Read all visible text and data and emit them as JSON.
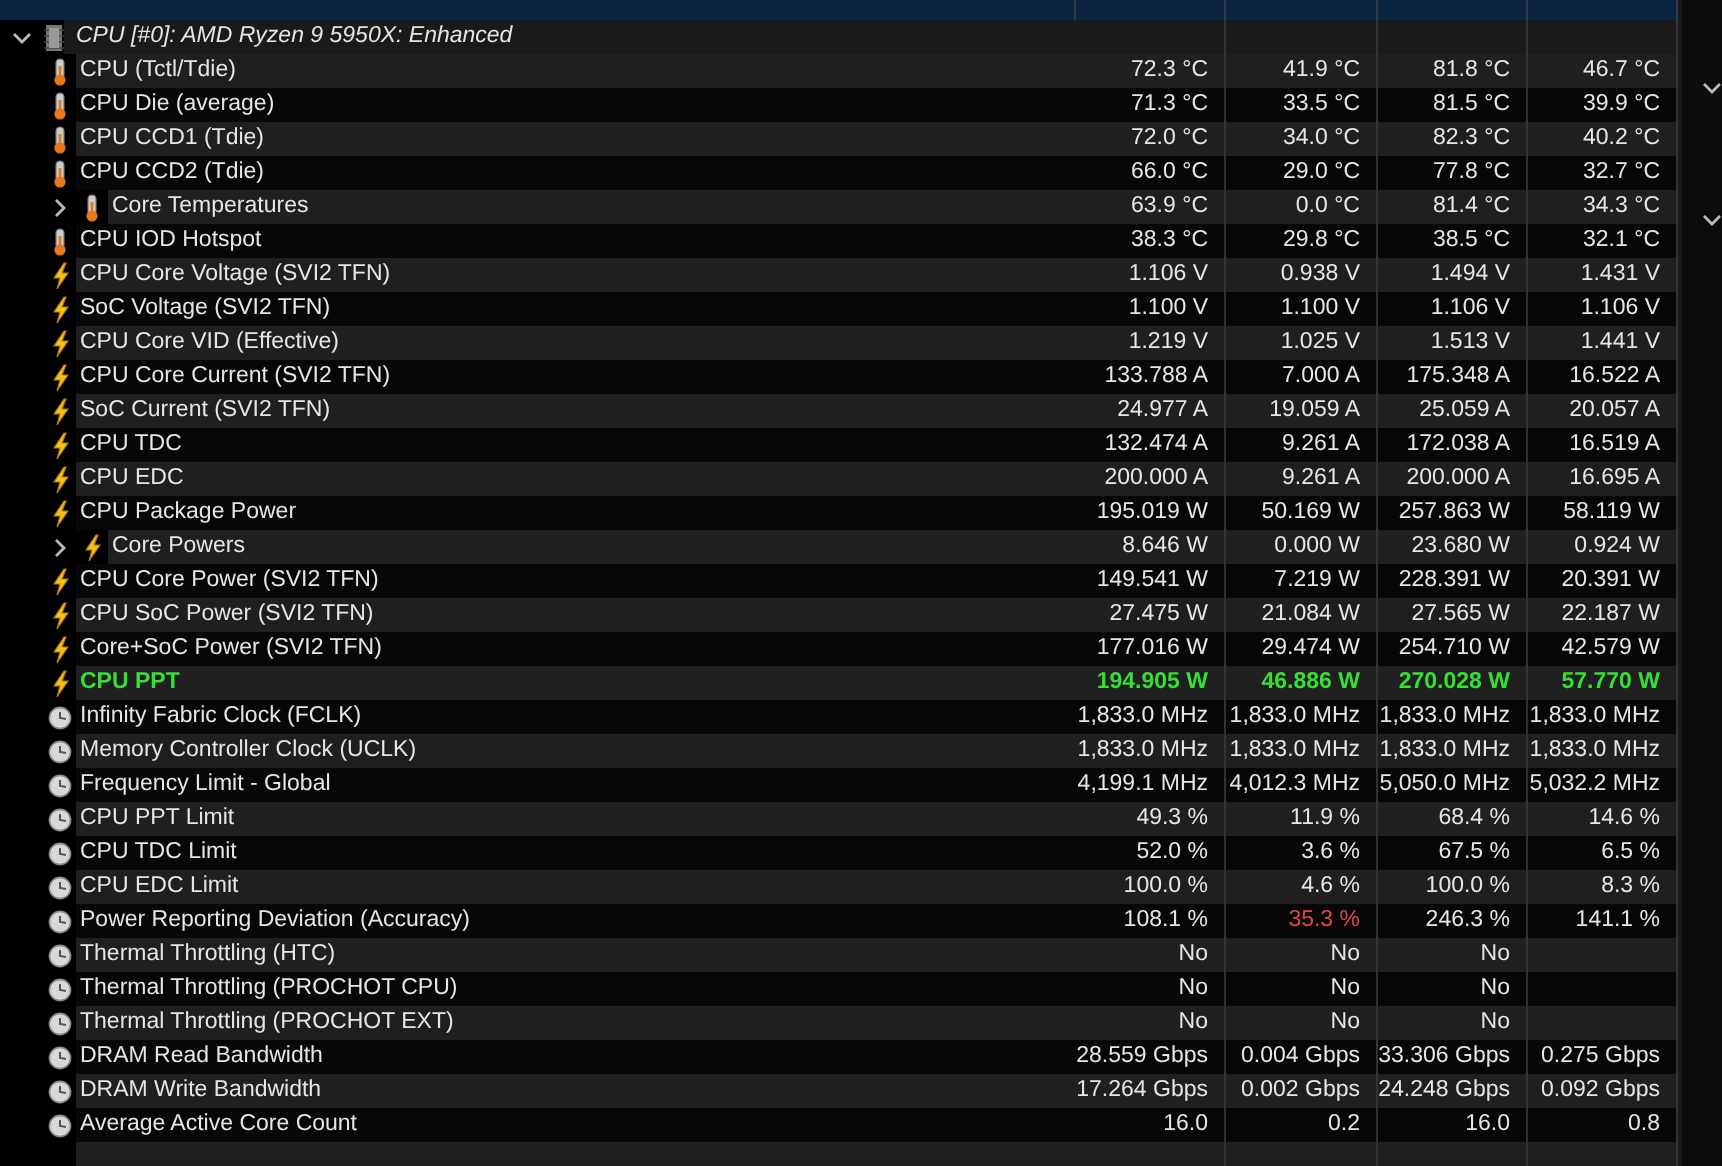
{
  "sensor_group": {
    "title": "CPU [#0]: AMD Ryzen 9 5950X: Enhanced",
    "expanded": true,
    "rows": [
      {
        "kind": "temp",
        "name": "CPU (Tctl/Tdie)",
        "highlight": false,
        "values": [
          "72.3 °C",
          "41.9 °C",
          "81.8 °C",
          "46.7 °C"
        ]
      },
      {
        "kind": "temp",
        "name": "CPU Die (average)",
        "highlight": false,
        "values": [
          "71.3 °C",
          "33.5 °C",
          "81.5 °C",
          "39.9 °C"
        ]
      },
      {
        "kind": "temp",
        "name": "CPU CCD1 (Tdie)",
        "highlight": false,
        "values": [
          "72.0 °C",
          "34.0 °C",
          "82.3 °C",
          "40.2 °C"
        ]
      },
      {
        "kind": "temp",
        "name": "CPU CCD2 (Tdie)",
        "highlight": false,
        "values": [
          "66.0 °C",
          "29.0 °C",
          "77.8 °C",
          "32.7 °C"
        ]
      },
      {
        "kind": "temp",
        "name": "Core Temperatures",
        "expanded": false,
        "highlight": false,
        "values": [
          "63.9 °C",
          "0.0 °C",
          "81.4 °C",
          "34.3 °C"
        ]
      },
      {
        "kind": "temp",
        "name": "CPU IOD Hotspot",
        "highlight": false,
        "values": [
          "38.3 °C",
          "29.8 °C",
          "38.5 °C",
          "32.1 °C"
        ]
      },
      {
        "kind": "power",
        "name": "CPU Core Voltage (SVI2 TFN)",
        "highlight": false,
        "values": [
          "1.106 V",
          "0.938 V",
          "1.494 V",
          "1.431 V"
        ]
      },
      {
        "kind": "power",
        "name": "SoC Voltage (SVI2 TFN)",
        "highlight": false,
        "values": [
          "1.100 V",
          "1.100 V",
          "1.106 V",
          "1.106 V"
        ]
      },
      {
        "kind": "power",
        "name": "CPU Core VID (Effective)",
        "highlight": false,
        "values": [
          "1.219 V",
          "1.025 V",
          "1.513 V",
          "1.441 V"
        ]
      },
      {
        "kind": "power",
        "name": "CPU Core Current (SVI2 TFN)",
        "highlight": false,
        "values": [
          "133.788 A",
          "7.000 A",
          "175.348 A",
          "16.522 A"
        ]
      },
      {
        "kind": "power",
        "name": "SoC Current (SVI2 TFN)",
        "highlight": false,
        "values": [
          "24.977 A",
          "19.059 A",
          "25.059 A",
          "20.057 A"
        ]
      },
      {
        "kind": "power",
        "name": "CPU TDC",
        "highlight": false,
        "values": [
          "132.474 A",
          "9.261 A",
          "172.038 A",
          "16.519 A"
        ]
      },
      {
        "kind": "power",
        "name": "CPU EDC",
        "highlight": false,
        "values": [
          "200.000 A",
          "9.261 A",
          "200.000 A",
          "16.695 A"
        ]
      },
      {
        "kind": "power",
        "name": "CPU Package Power",
        "highlight": false,
        "values": [
          "195.019 W",
          "50.169 W",
          "257.863 W",
          "58.119 W"
        ]
      },
      {
        "kind": "power",
        "name": "Core Powers",
        "expanded": false,
        "highlight": false,
        "values": [
          "8.646 W",
          "0.000 W",
          "23.680 W",
          "0.924 W"
        ]
      },
      {
        "kind": "power",
        "name": "CPU Core Power (SVI2 TFN)",
        "highlight": false,
        "values": [
          "149.541 W",
          "7.219 W",
          "228.391 W",
          "20.391 W"
        ]
      },
      {
        "kind": "power",
        "name": "CPU SoC Power (SVI2 TFN)",
        "highlight": false,
        "values": [
          "27.475 W",
          "21.084 W",
          "27.565 W",
          "22.187 W"
        ]
      },
      {
        "kind": "power",
        "name": "Core+SoC Power (SVI2 TFN)",
        "highlight": false,
        "values": [
          "177.016 W",
          "29.474 W",
          "254.710 W",
          "42.579 W"
        ]
      },
      {
        "kind": "power",
        "name": "CPU PPT",
        "highlight": true,
        "values": [
          "194.905 W",
          "46.886 W",
          "270.028 W",
          "57.770 W"
        ]
      },
      {
        "kind": "clock",
        "name": "Infinity Fabric Clock (FCLK)",
        "highlight": false,
        "values": [
          "1,833.0 MHz",
          "1,833.0 MHz",
          "1,833.0 MHz",
          "1,833.0 MHz"
        ]
      },
      {
        "kind": "clock",
        "name": "Memory Controller Clock (UCLK)",
        "highlight": false,
        "values": [
          "1,833.0 MHz",
          "1,833.0 MHz",
          "1,833.0 MHz",
          "1,833.0 MHz"
        ]
      },
      {
        "kind": "clock",
        "name": "Frequency Limit - Global",
        "highlight": false,
        "values": [
          "4,199.1 MHz",
          "4,012.3 MHz",
          "5,050.0 MHz",
          "5,032.2 MHz"
        ]
      },
      {
        "kind": "clock",
        "name": "CPU PPT Limit",
        "highlight": false,
        "values": [
          "49.3 %",
          "11.9 %",
          "68.4 %",
          "14.6 %"
        ]
      },
      {
        "kind": "clock",
        "name": "CPU TDC Limit",
        "highlight": false,
        "values": [
          "52.0 %",
          "3.6 %",
          "67.5 %",
          "6.5 %"
        ]
      },
      {
        "kind": "clock",
        "name": "CPU EDC Limit",
        "highlight": false,
        "values": [
          "100.0 %",
          "4.6 %",
          "100.0 %",
          "8.3 %"
        ]
      },
      {
        "kind": "clock",
        "name": "Power Reporting Deviation (Accuracy)",
        "highlight": false,
        "alerts": [
          false,
          true,
          false,
          false
        ],
        "values": [
          "108.1 %",
          "35.3 %",
          "246.3 %",
          "141.1 %"
        ]
      },
      {
        "kind": "clock",
        "name": "Thermal Throttling (HTC)",
        "highlight": false,
        "values": [
          "No",
          "No",
          "No"
        ]
      },
      {
        "kind": "clock",
        "name": "Thermal Throttling (PROCHOT CPU)",
        "highlight": false,
        "values": [
          "No",
          "No",
          "No"
        ]
      },
      {
        "kind": "clock",
        "name": "Thermal Throttling (PROCHOT EXT)",
        "highlight": false,
        "values": [
          "No",
          "No",
          "No"
        ]
      },
      {
        "kind": "clock",
        "name": "DRAM Read Bandwidth",
        "highlight": false,
        "values": [
          "28.559 Gbps",
          "0.004 Gbps",
          "33.306 Gbps",
          "0.275 Gbps"
        ]
      },
      {
        "kind": "clock",
        "name": "DRAM Write Bandwidth",
        "highlight": false,
        "values": [
          "17.264 Gbps",
          "0.002 Gbps",
          "24.248 Gbps",
          "0.092 Gbps"
        ]
      },
      {
        "kind": "clock",
        "name": "Average Active Core Count",
        "highlight": false,
        "values": [
          "16.0",
          "0.2",
          "16.0",
          "0.8"
        ]
      }
    ]
  }
}
